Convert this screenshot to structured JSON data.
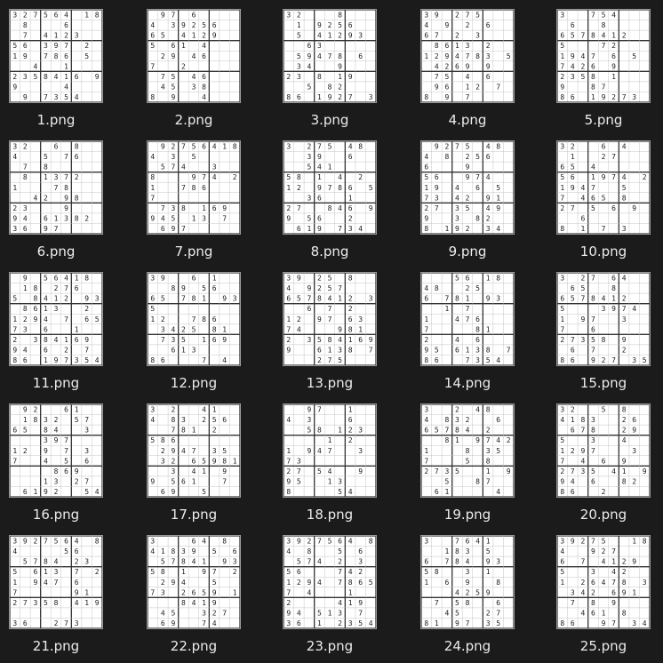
{
  "files": [
    {
      "name": "1.png",
      "rows": [
        "3 27564 18",
        "  8      6",
        "   7 412 3",
        "5 6  397 2",
        "1 9  786 5",
        "    4    1",
        "2 358416 9",
        "9        4",
        "   9  7354"
      ]
    },
    {
      "name": "2.png",
      "rows": [
        "  9 7 6  ",
        "4   39256",
        "6 5  4129",
        "5  6 1  4",
        "  2 9 4 6",
        "7    2   ",
        "  7 5 4 6",
        "  4 5  38",
        "8   9   4"
      ]
    },
    {
      "name": "3.png",
      "rows": [
        "3 2      8",
        "  1  925 6",
        "  5  4129 3",
        "    6 3  ",
        "  5 9478 6",
        "  3 4   9",
        "2 3 8  1 9",
        "    5  8 2",
        "8 6 1 927 3"
      ]
    },
    {
      "name": "4.png",
      "rows": [
        "3 9 275   ",
        "4   9  2 6",
        "6 7  2  3 ",
        "  8 613  2",
        "1 294783 5",
        "  4 269  9",
        "  7 5  4 6",
        "  9 6 1 2 7",
        "8   9 7  "
      ]
    },
    {
      "name": "5.png",
      "rows": [
        "3    75 4 ",
        "  6     8 ",
        "6 578412  ",
        "5      7 2",
        "1 947  6 5",
        "7 426 9   ",
        "2 358  1  ",
        "9    8 7  ",
        "8 6 1927 3"
      ]
    },
    {
      "name": "6.png",
      "rows": [
        "3 2    6 8",
        "4     5 76",
        "   7 8    ",
        "   8 13 72",
        "1      7 8",
        "    42  98",
        "2 3      9",
        "9 4 613 82",
        "3 6  97  "
      ]
    },
    {
      "name": "7.png",
      "rows": [
        "  9275641 8",
        "4   3  5  ",
        "  57 4   3",
        "8       974 2",
        "1    786  ",
        "7        ",
        "  73 8 169",
        "9 45  13  7",
        "  6 97    "
      ]
    },
    {
      "name": "8.png",
      "rows": [
        "3  275  4 8",
        "     39   6",
        "    5 41  ",
        "5 8 1   4 2",
        "1 2 9 786 5",
        "    3 6   1",
        "2 7   84 6 9",
        "9   56   2 ",
        "  6 19 73 4"
      ]
    },
    {
      "name": "9.png",
      "rows": [
        "  9275  4 8",
        "4  8  25 6",
        "6       9 ",
        "5 6   974 ",
        "1 9 4   6 5",
        "7 3 42  9 1",
        "2 7 35  4 9",
        "9     3 8 2",
        "8  1 92 3 4"
      ]
    },
    {
      "name": "10.png",
      "rows": [
        "3 2    6 4",
        "  1    2 7",
        "6 5  4    ",
        "5 6 1 974 2",
        "1 947    5",
        "7  4 65  8",
        "2 7 5   6 9",
        "    6     ",
        "8   1  7 3"
      ]
    },
    {
      "name": "11.png",
      "rows": [
        "  9  56418",
        "  18  2 76",
        "5  841 2 93",
        "  8613    2",
        "1 294 7  65",
        "7 3  6   1",
        "2  3 84169",
        "9 4 6   2 7",
        "8 6 19 7354"
      ]
    },
    {
      "name": "12.png",
      "rows": [
        "3 9    6 1",
        "    8 9 5 6",
        "6 5 78 1 93",
        "5          ",
        "1 2   786 ",
        "  342 5 81",
        "  735   169",
        "    613    ",
        "8 6      7 4"
      ]
    },
    {
      "name": "13.png",
      "rows": [
        "3 9 25   8",
        "4   9257  ",
        "6 578412 3",
        "    6   7 2",
        "1 2 9 7 63 ",
        "7 4     981",
        "2  358416 9",
        "9    613 8 7",
        "      275 "
      ]
    },
    {
      "name": "14.png",
      "rows": [
        "       56 1 8",
        "4 8   25    ",
        "6  78 1 93",
        "    1  7   ",
        "1    47 6  ",
        "7        81",
        "2    4  6  ",
        "9 5 613 8 7",
        "8 6    7354"
      ]
    },
    {
      "name": "15.png",
      "rows": [
        "3  2 7 64 ",
        "  6 5   8 ",
        "6 578412  ",
        "5      397 4",
        "1  9 7   3",
        "7     6    ",
        "2 7358  9  ",
        "  6  7    2",
        "8 6  927 3 5"
      ]
    },
    {
      "name": "16.png",
      "rows": [
        "  92    6 1",
        "  183 2 57",
        "6 5  84   3",
        "      397  ",
        "1 2 9  7  3",
        "7    4   5 6",
        "        8 69",
        "      1 3 27",
        "  6 192   54"
      ]
    },
    {
      "name": "17.png",
      "rows": [
        "3  2    41 ",
        "4   83 25 6",
        "    78 1 2 ",
        "5 86       ",
        "  2947   35",
        "  3 2 659 81",
        "     3  41 9",
        "9  561    7",
        "  6 9   5  "
      ]
    },
    {
      "name": "18.png",
      "rows": [
        "    97     1",
        "4   3      6",
        "    5 8 12 3",
        "        1  2",
        "1  947    3",
        "7 3         ",
        "2 7 5 4   9",
        "9 5   13   ",
        "8        54"
      ]
    },
    {
      "name": "19.png",
      "rows": [
        "3     2 4 8",
        "4  8 32   6",
        "6 5784 2   ",
        "    8 1 974 2",
        "1       8 3 5",
        "7       5 8 ",
        "2 735   1  9",
        "    5    8 7",
        "  6 1       4"
      ]
    },
    {
      "name": "20.png",
      "rows": [
        "3 2   5   8",
        "4 183   2 6",
        "  6 78   29",
        "5     3   4",
        "1 297     3",
        "7   4  6 9 ",
        "2 735  41 9",
        "9 4 6    82",
        "8 6   2    "
      ]
    },
    {
      "name": "21.png",
      "rows": [
        "3 927564 8",
        "4        56",
        "  5 784 2 3",
        "5   613  7 2",
        "1   947 6   ",
        "7          91",
        "2 7358 41 9",
        "              ",
        "3 6    273 "
      ]
    },
    {
      "name": "22.png",
      "rows": [
        "3       64 8",
        "4 1839  5 6",
        "  5 7841 93",
        "5 8 1   97 2",
        "  294    5 ",
        "7 3 2659  1",
        "      841 9",
        "  4 5   3 27",
        "  6 9   7 4"
      ]
    },
    {
      "name": "23.png",
      "rows": [
        "3 927564 8",
        "4  8     5 6",
        "  57 4  2 3",
        "5 6     742",
        "1 294 786 5",
        "7  4      1",
        "2        41 9",
        "9 4 5 13 7",
        "3 6 1  2 354"
      ]
    },
    {
      "name": "24.png",
      "rows": [
        "3    7 641 ",
        "    183  5 ",
        "6  784   93",
        "5 8   3   1",
        "1   6 9    8",
        "      42 59",
        "  7  5 8   6",
        "    45    27",
        "8 1 9 7 35 "
      ]
    },
    {
      "name": "25.png",
      "rows": [
        "3 9275    18",
        "4    9 27",
        "6   7 4129",
        "5     3  42",
        "1  2 6478 35",
        "   342 6 91",
        "  7  8  9  ",
        "    4 61  8",
        "8 6    97 34"
      ]
    }
  ]
}
